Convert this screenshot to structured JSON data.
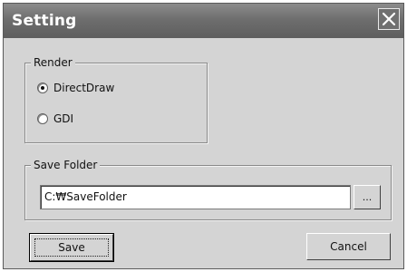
{
  "window": {
    "title": "Setting",
    "close_icon": "close-icon"
  },
  "render_group": {
    "legend": "Render",
    "options": [
      {
        "label": "DirectDraw",
        "selected": true
      },
      {
        "label": "GDI",
        "selected": false
      }
    ]
  },
  "save_folder_group": {
    "legend": "Save Folder",
    "path_value": "C:₩SaveFolder",
    "browse_label": "..."
  },
  "buttons": {
    "save_label": "Save",
    "cancel_label": "Cancel"
  },
  "colors": {
    "dialog_bg": "#d4d4d4",
    "titlebar": "#6e6e6e",
    "title_text": "#ffffff"
  }
}
